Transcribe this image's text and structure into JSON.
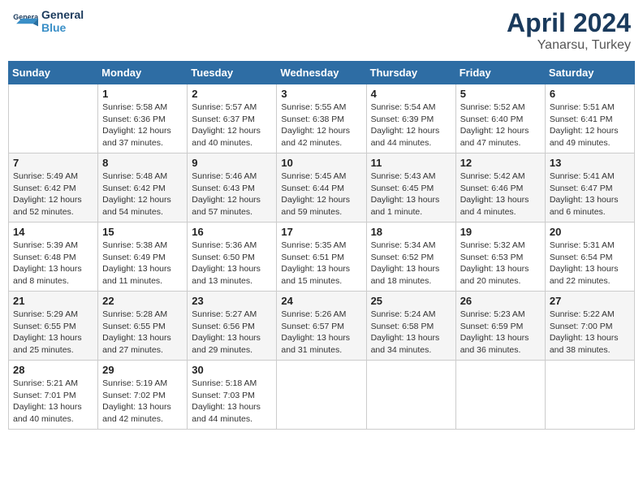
{
  "header": {
    "logo_text_general": "General",
    "logo_text_blue": "Blue",
    "month_title": "April 2024",
    "location": "Yanarsu, Turkey"
  },
  "days_of_week": [
    "Sunday",
    "Monday",
    "Tuesday",
    "Wednesday",
    "Thursday",
    "Friday",
    "Saturday"
  ],
  "weeks": [
    [
      {
        "date": "",
        "sunrise": "",
        "sunset": "",
        "daylight": ""
      },
      {
        "date": "1",
        "sunrise": "Sunrise: 5:58 AM",
        "sunset": "Sunset: 6:36 PM",
        "daylight": "Daylight: 12 hours and 37 minutes."
      },
      {
        "date": "2",
        "sunrise": "Sunrise: 5:57 AM",
        "sunset": "Sunset: 6:37 PM",
        "daylight": "Daylight: 12 hours and 40 minutes."
      },
      {
        "date": "3",
        "sunrise": "Sunrise: 5:55 AM",
        "sunset": "Sunset: 6:38 PM",
        "daylight": "Daylight: 12 hours and 42 minutes."
      },
      {
        "date": "4",
        "sunrise": "Sunrise: 5:54 AM",
        "sunset": "Sunset: 6:39 PM",
        "daylight": "Daylight: 12 hours and 44 minutes."
      },
      {
        "date": "5",
        "sunrise": "Sunrise: 5:52 AM",
        "sunset": "Sunset: 6:40 PM",
        "daylight": "Daylight: 12 hours and 47 minutes."
      },
      {
        "date": "6",
        "sunrise": "Sunrise: 5:51 AM",
        "sunset": "Sunset: 6:41 PM",
        "daylight": "Daylight: 12 hours and 49 minutes."
      }
    ],
    [
      {
        "date": "7",
        "sunrise": "Sunrise: 5:49 AM",
        "sunset": "Sunset: 6:42 PM",
        "daylight": "Daylight: 12 hours and 52 minutes."
      },
      {
        "date": "8",
        "sunrise": "Sunrise: 5:48 AM",
        "sunset": "Sunset: 6:42 PM",
        "daylight": "Daylight: 12 hours and 54 minutes."
      },
      {
        "date": "9",
        "sunrise": "Sunrise: 5:46 AM",
        "sunset": "Sunset: 6:43 PM",
        "daylight": "Daylight: 12 hours and 57 minutes."
      },
      {
        "date": "10",
        "sunrise": "Sunrise: 5:45 AM",
        "sunset": "Sunset: 6:44 PM",
        "daylight": "Daylight: 12 hours and 59 minutes."
      },
      {
        "date": "11",
        "sunrise": "Sunrise: 5:43 AM",
        "sunset": "Sunset: 6:45 PM",
        "daylight": "Daylight: 13 hours and 1 minute."
      },
      {
        "date": "12",
        "sunrise": "Sunrise: 5:42 AM",
        "sunset": "Sunset: 6:46 PM",
        "daylight": "Daylight: 13 hours and 4 minutes."
      },
      {
        "date": "13",
        "sunrise": "Sunrise: 5:41 AM",
        "sunset": "Sunset: 6:47 PM",
        "daylight": "Daylight: 13 hours and 6 minutes."
      }
    ],
    [
      {
        "date": "14",
        "sunrise": "Sunrise: 5:39 AM",
        "sunset": "Sunset: 6:48 PM",
        "daylight": "Daylight: 13 hours and 8 minutes."
      },
      {
        "date": "15",
        "sunrise": "Sunrise: 5:38 AM",
        "sunset": "Sunset: 6:49 PM",
        "daylight": "Daylight: 13 hours and 11 minutes."
      },
      {
        "date": "16",
        "sunrise": "Sunrise: 5:36 AM",
        "sunset": "Sunset: 6:50 PM",
        "daylight": "Daylight: 13 hours and 13 minutes."
      },
      {
        "date": "17",
        "sunrise": "Sunrise: 5:35 AM",
        "sunset": "Sunset: 6:51 PM",
        "daylight": "Daylight: 13 hours and 15 minutes."
      },
      {
        "date": "18",
        "sunrise": "Sunrise: 5:34 AM",
        "sunset": "Sunset: 6:52 PM",
        "daylight": "Daylight: 13 hours and 18 minutes."
      },
      {
        "date": "19",
        "sunrise": "Sunrise: 5:32 AM",
        "sunset": "Sunset: 6:53 PM",
        "daylight": "Daylight: 13 hours and 20 minutes."
      },
      {
        "date": "20",
        "sunrise": "Sunrise: 5:31 AM",
        "sunset": "Sunset: 6:54 PM",
        "daylight": "Daylight: 13 hours and 22 minutes."
      }
    ],
    [
      {
        "date": "21",
        "sunrise": "Sunrise: 5:29 AM",
        "sunset": "Sunset: 6:55 PM",
        "daylight": "Daylight: 13 hours and 25 minutes."
      },
      {
        "date": "22",
        "sunrise": "Sunrise: 5:28 AM",
        "sunset": "Sunset: 6:55 PM",
        "daylight": "Daylight: 13 hours and 27 minutes."
      },
      {
        "date": "23",
        "sunrise": "Sunrise: 5:27 AM",
        "sunset": "Sunset: 6:56 PM",
        "daylight": "Daylight: 13 hours and 29 minutes."
      },
      {
        "date": "24",
        "sunrise": "Sunrise: 5:26 AM",
        "sunset": "Sunset: 6:57 PM",
        "daylight": "Daylight: 13 hours and 31 minutes."
      },
      {
        "date": "25",
        "sunrise": "Sunrise: 5:24 AM",
        "sunset": "Sunset: 6:58 PM",
        "daylight": "Daylight: 13 hours and 34 minutes."
      },
      {
        "date": "26",
        "sunrise": "Sunrise: 5:23 AM",
        "sunset": "Sunset: 6:59 PM",
        "daylight": "Daylight: 13 hours and 36 minutes."
      },
      {
        "date": "27",
        "sunrise": "Sunrise: 5:22 AM",
        "sunset": "Sunset: 7:00 PM",
        "daylight": "Daylight: 13 hours and 38 minutes."
      }
    ],
    [
      {
        "date": "28",
        "sunrise": "Sunrise: 5:21 AM",
        "sunset": "Sunset: 7:01 PM",
        "daylight": "Daylight: 13 hours and 40 minutes."
      },
      {
        "date": "29",
        "sunrise": "Sunrise: 5:19 AM",
        "sunset": "Sunset: 7:02 PM",
        "daylight": "Daylight: 13 hours and 42 minutes."
      },
      {
        "date": "30",
        "sunrise": "Sunrise: 5:18 AM",
        "sunset": "Sunset: 7:03 PM",
        "daylight": "Daylight: 13 hours and 44 minutes."
      },
      {
        "date": "",
        "sunrise": "",
        "sunset": "",
        "daylight": ""
      },
      {
        "date": "",
        "sunrise": "",
        "sunset": "",
        "daylight": ""
      },
      {
        "date": "",
        "sunrise": "",
        "sunset": "",
        "daylight": ""
      },
      {
        "date": "",
        "sunrise": "",
        "sunset": "",
        "daylight": ""
      }
    ]
  ]
}
